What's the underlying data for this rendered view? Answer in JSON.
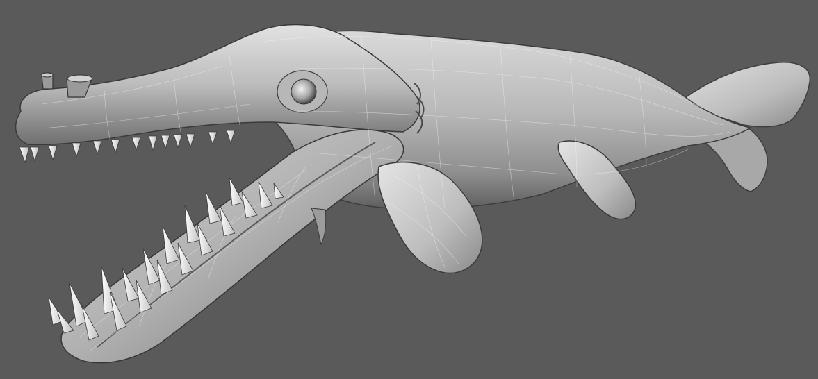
{
  "viewport": {
    "background": "#5a5a5a"
  },
  "model": {
    "subject": "whale-like-sea-creature-mesh",
    "shading": "clay-grey",
    "base_color": "#bdbdbd",
    "highlight_color": "#e9e9e9",
    "shadow_color": "#3a3a3a",
    "wire_color": "#f5f5f5",
    "tooth_color": "#f2f2f2"
  }
}
